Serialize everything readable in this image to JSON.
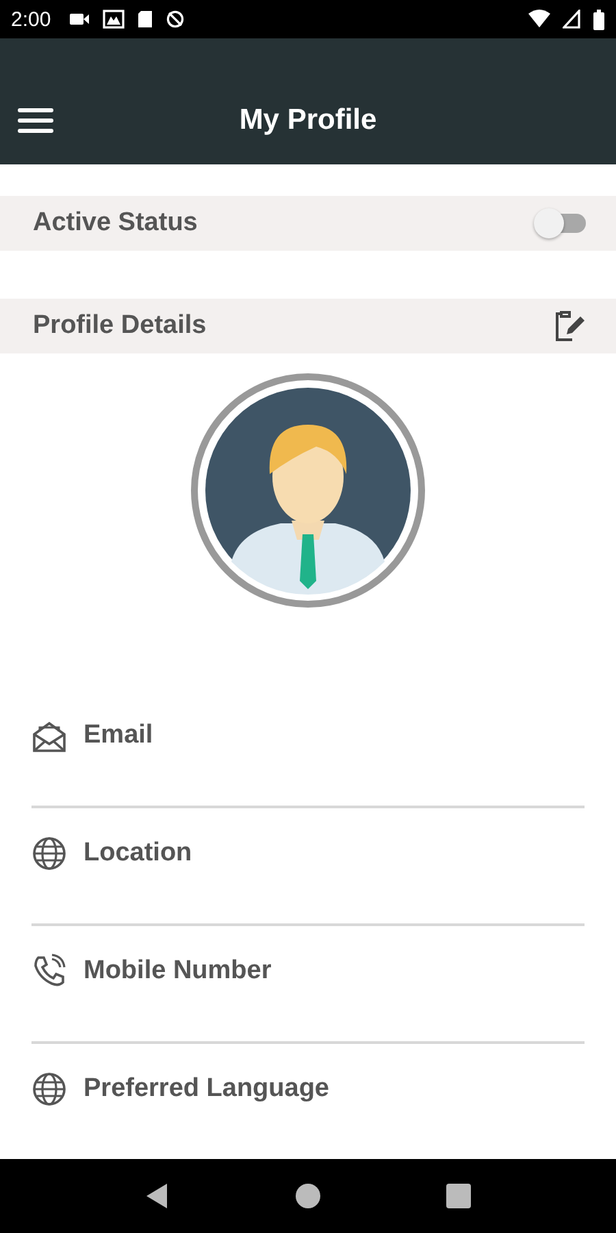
{
  "status_bar": {
    "time": "2:00"
  },
  "app_bar": {
    "title": "My Profile"
  },
  "active_status": {
    "label": "Active Status",
    "on": false
  },
  "profile_details": {
    "label": "Profile Details"
  },
  "fields": [
    {
      "label": "Email"
    },
    {
      "label": "Location"
    },
    {
      "label": "Mobile Number"
    },
    {
      "label": "Preferred Language"
    }
  ]
}
